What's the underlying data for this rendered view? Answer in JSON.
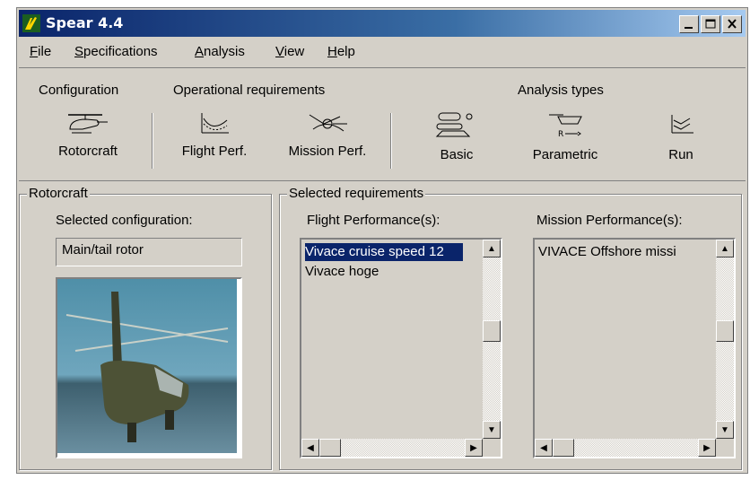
{
  "window": {
    "title": "Spear 4.4"
  },
  "menu": [
    {
      "label": "File",
      "u": "F",
      "rest": "ile"
    },
    {
      "label": "Specifications",
      "u": "S",
      "rest": "pecifications"
    },
    {
      "label": "Analysis",
      "u": "A",
      "rest": "nalysis"
    },
    {
      "label": "View",
      "u": "V",
      "rest": "iew"
    },
    {
      "label": "Help",
      "u": "H",
      "rest": "elp"
    }
  ],
  "toolbar": {
    "groups": {
      "configuration": "Configuration",
      "operational": "Operational requirements",
      "analysis": "Analysis types"
    },
    "buttons": {
      "rotorcraft": "Rotorcraft",
      "flight_perf": "Flight Perf.",
      "mission_perf": "Mission Perf.",
      "basic": "Basic",
      "parametric": "Parametric",
      "run": "Run"
    }
  },
  "rotorcraft_panel": {
    "title": "Rotorcraft",
    "selected_label": "Selected configuration:",
    "selected_value": "Main/tail rotor"
  },
  "requirements_panel": {
    "title": "Selected requirements",
    "flight_label": "Flight Performance(s):",
    "flight_items": [
      "Vivace cruise speed 12",
      "Vivace hoge"
    ],
    "mission_label": "Mission Performance(s):",
    "mission_items": [
      "VIVACE Offshore missi"
    ]
  },
  "colors": {
    "selection": "#0a246a",
    "face": "#d4d0c8",
    "titlebar": "#0a246a"
  }
}
